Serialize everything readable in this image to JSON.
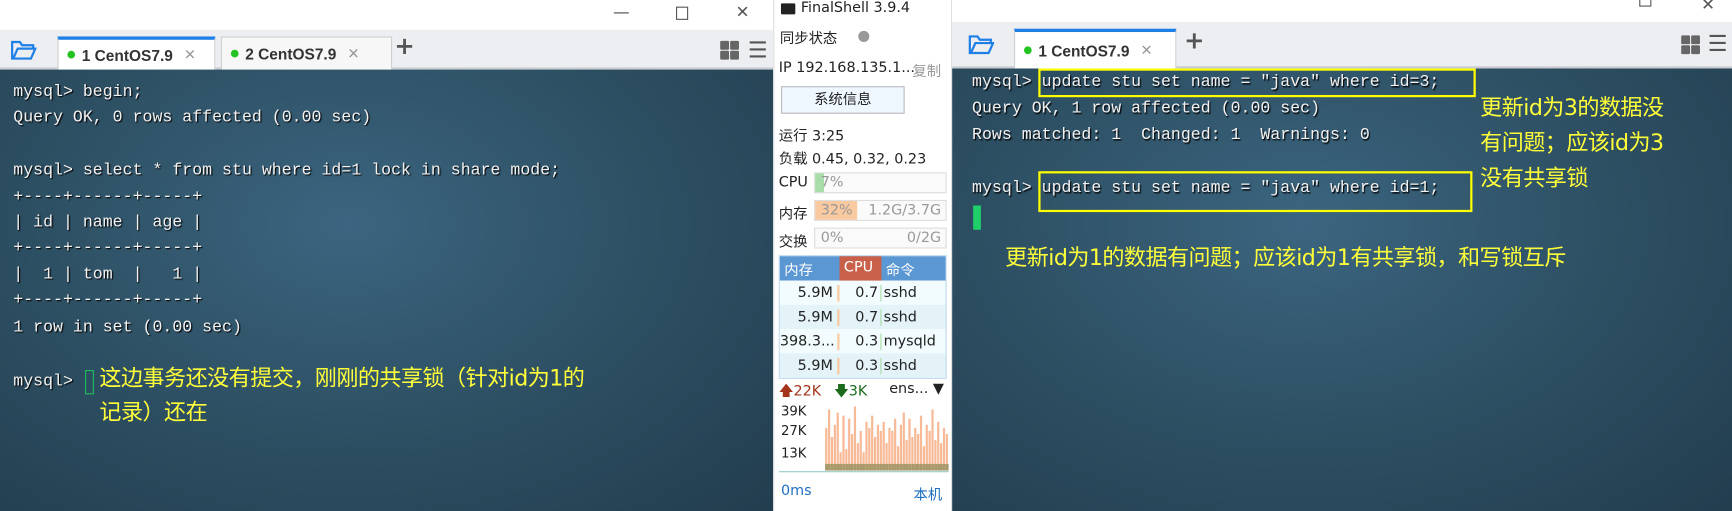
{
  "left_window": {
    "tabs": [
      {
        "label": "1 CentOS7.9",
        "active": true
      },
      {
        "label": "2 CentOS7.9",
        "active": false
      }
    ],
    "terminal_lines": [
      "mysql> begin;",
      "Query OK, 0 rows affected (0.00 sec)",
      "mysql> select * from stu where id=1 lock in share mode;",
      "+----+------+-----+",
      "| id | name | age |",
      "+----+------+-----+",
      "|  1 | tom  |   1 |",
      "+----+------+-----+",
      "1 row in set (0.00 sec)",
      "mysql>"
    ],
    "annotation_lines": [
      "这边事务还没有提交，刚刚的共享锁（针对id为1的",
      "记录）还在"
    ]
  },
  "sidebar": {
    "app_title": "FinalShell 3.9.4",
    "sync_label": "同步状态",
    "ip": "IP 192.168.135.1...",
    "copy_label": "复制",
    "sysinfo_button": "系统信息",
    "uptime": "运行 3:25",
    "load": "负载 0.45, 0.32, 0.23",
    "cpu": {
      "label": "CPU",
      "text": "7%",
      "percent": 7,
      "color": "#a8dca8"
    },
    "mem": {
      "label": "内存",
      "text": "32%",
      "usage": "1.2G/3.7G",
      "percent": 32,
      "color": "#f9c9a0"
    },
    "swap": {
      "label": "交换",
      "text": "0%",
      "usage": "0/2G",
      "percent": 0
    },
    "process_headers": [
      "内存",
      "CPU",
      "命令"
    ],
    "processes": [
      {
        "mem": "5.9M",
        "cpu": "0.7",
        "cmd": "sshd"
      },
      {
        "mem": "5.9M",
        "cpu": "0.7",
        "cmd": "sshd"
      },
      {
        "mem": "398.3...",
        "cpu": "0.3",
        "cmd": "mysqld"
      },
      {
        "mem": "5.9M",
        "cpu": "0.3",
        "cmd": "sshd"
      }
    ],
    "net": {
      "up": "22K",
      "down": "3K",
      "iface": "ens...",
      "ticks": [
        "39K",
        "27K",
        "13K"
      ]
    },
    "net_history": [
      28,
      40,
      22,
      30,
      38,
      12,
      36,
      14,
      34,
      24,
      42,
      18,
      26,
      12,
      32,
      28,
      36,
      22,
      30,
      26,
      32,
      18,
      28,
      26,
      34,
      16,
      30,
      38,
      20,
      34,
      22,
      28,
      24,
      36,
      16,
      30,
      26,
      40,
      20,
      32,
      18,
      28,
      24
    ],
    "latency": "0ms",
    "host_label": "本机"
  },
  "right_window": {
    "tabs": [
      {
        "label": "1 CentOS7.9",
        "active": true
      }
    ],
    "terminal_lines": [
      "mysql> update stu set name = \"java\" where id=3;",
      "Query OK, 1 row affected (0.00 sec)",
      "Rows matched: 1  Changed: 1  Warnings: 0",
      "mysql> update stu set name = \"java\" where id=1;"
    ],
    "annotation_side": [
      "更新id为3的数据没",
      "有问题；应该id为3",
      "没有共享锁"
    ],
    "annotation_bottom": "更新id为1的数据有问题；应该id为1有共享锁，和写锁互斥"
  }
}
